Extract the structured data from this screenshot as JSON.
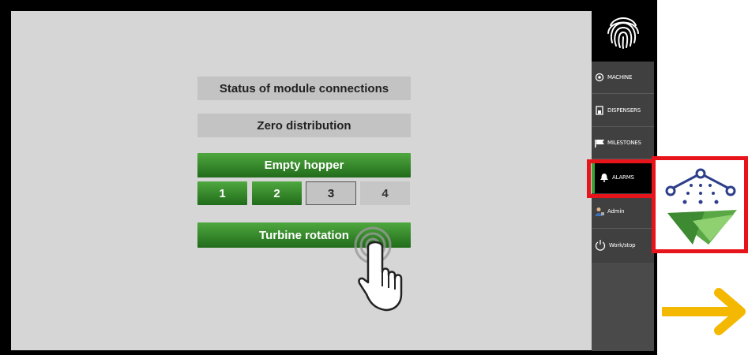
{
  "main": {
    "status_button": "Status of module connections",
    "zero_button": "Zero distribution",
    "empty_hopper_button": "Empty hopper",
    "hopper_numbers": [
      "1",
      "2",
      "3",
      "4"
    ],
    "turbine_button": "Turbine rotation"
  },
  "sidebar": {
    "items": [
      {
        "label": "MACHINE",
        "icon": "gear-icon"
      },
      {
        "label": "DISPENSERS",
        "icon": "dispenser-icon"
      },
      {
        "label": "MILESTONES",
        "icon": "flag-icon"
      },
      {
        "label": "ALARMS",
        "icon": "bell-icon",
        "active": true
      },
      {
        "label": "Admin",
        "icon": "user-icon"
      },
      {
        "label": "Work/stop",
        "icon": "power-icon"
      }
    ]
  },
  "colors": {
    "green_button": "#3a8f2f",
    "highlight_red": "#e8141b",
    "arrow_yellow": "#f5b800",
    "active_indicator": "#3aa33a"
  }
}
